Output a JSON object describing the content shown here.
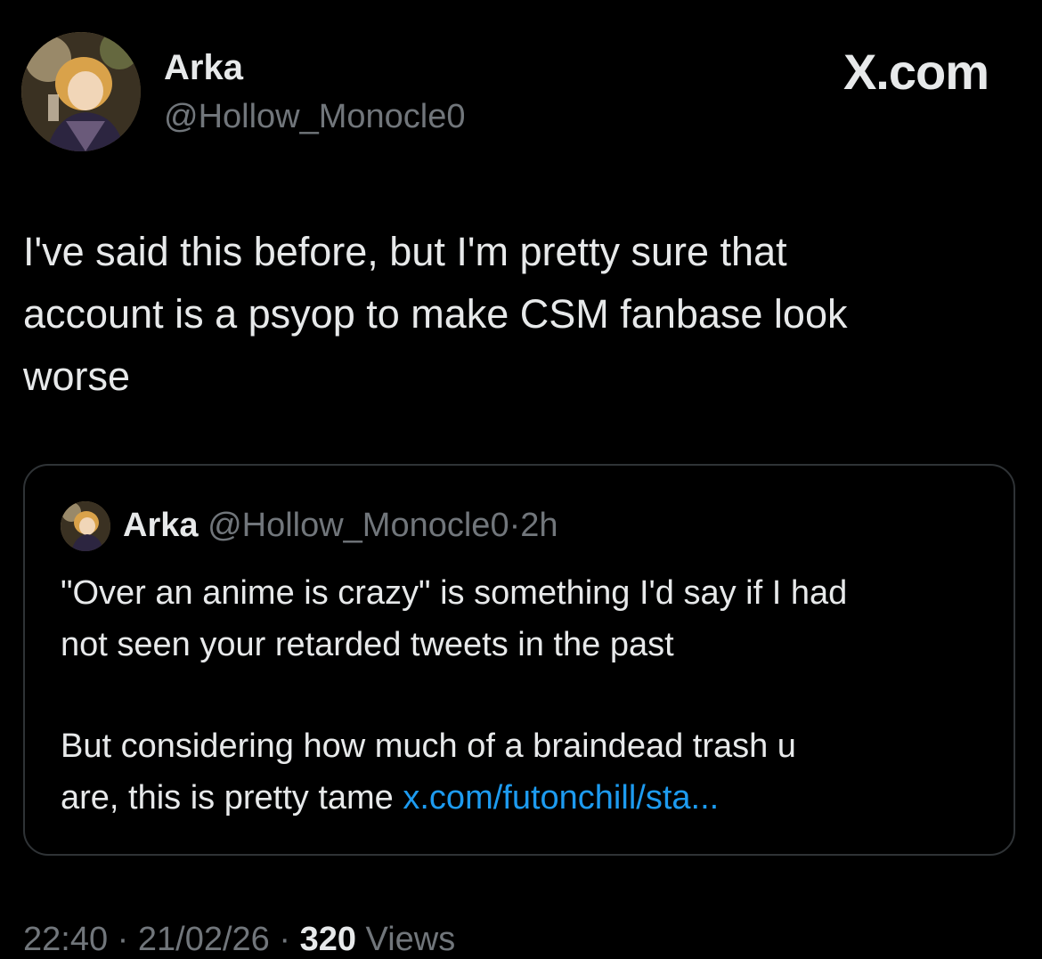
{
  "author": {
    "name": "Arka",
    "handle": "@Hollow_Monocle0"
  },
  "brand": "X.com",
  "tweet": {
    "lines": [
      "I've said this before, but I'm pretty sure that",
      "account is a psyop to make CSM fanbase look",
      "worse"
    ]
  },
  "quote": {
    "name": "Arka",
    "handle": "@Hollow_Monocle0",
    "separator": "·",
    "time": "2h",
    "paragraph1_lines": [
      "\"Over an anime is crazy\" is something I'd say if I had",
      "not seen your retarded tweets in the past"
    ],
    "paragraph2_lines": [
      "But considering how much of a braindead trash u",
      "are, this is pretty tame "
    ],
    "link": "x.com/futonchill/sta..."
  },
  "footer": {
    "time": "22:40",
    "date": "21/02/26",
    "separator": "·",
    "views_count": "320",
    "views_label": "Views"
  },
  "icons": {
    "avatar": "avatar",
    "quote_avatar": "avatar"
  },
  "colors": {
    "background": "#000000",
    "text_primary": "#e7e9ea",
    "text_secondary": "#71767b",
    "link": "#1d9bf0",
    "card_border": "#2f3336"
  }
}
